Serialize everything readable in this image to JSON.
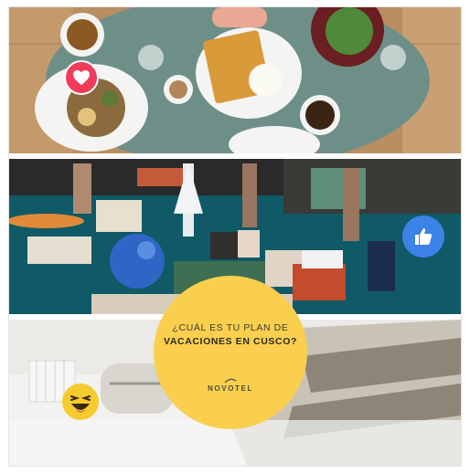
{
  "post": {
    "question_line1": "¿CUÁL ES TU PLAN DE",
    "question_line2": "VACACIONES EN CUSCO?",
    "brand": "NOVOTEL"
  },
  "reactions": [
    {
      "name": "love",
      "icon": "heart-icon",
      "color": "#f03b5b"
    },
    {
      "name": "like",
      "icon": "thumbs-up-icon",
      "color": "#3d82e6"
    },
    {
      "name": "haha",
      "icon": "laughing-emoji-icon",
      "color": "#f6cb2e"
    }
  ],
  "colors": {
    "circle": "#f9cf4d",
    "table": "#6e8f88",
    "lobby_floor": "#0f5a66",
    "bed_white": "#f2f2f0"
  }
}
